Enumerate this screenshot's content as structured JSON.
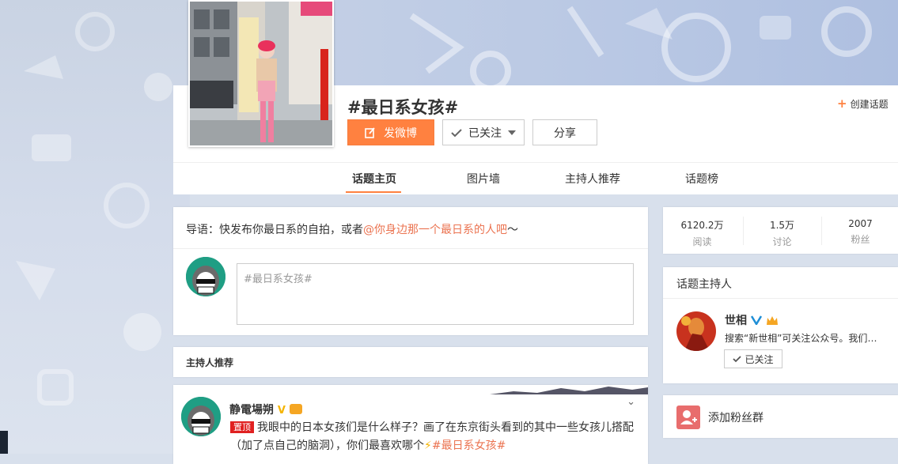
{
  "colors": {
    "accent": "#ff8140",
    "link": "#eb7350",
    "pin": "#e02020",
    "verified": "#1e8ed6"
  },
  "topic": {
    "title": "#最日系女孩#",
    "post_button": "发微博",
    "follow_button": "已关注",
    "share_button": "分享",
    "create_topic": "创建话题"
  },
  "tabs": [
    {
      "label": "话题主页",
      "active": true
    },
    {
      "label": "图片墙",
      "active": false
    },
    {
      "label": "主持人推荐",
      "active": false
    },
    {
      "label": "话题榜",
      "active": false
    }
  ],
  "intro": {
    "prefix": "导语：快发布你最日系的自拍，或者",
    "link": "@你身边那一个最日系的人吧",
    "suffix": "～"
  },
  "composer": {
    "placeholder": "#最日系女孩#"
  },
  "host_recommend": {
    "title": "主持人推荐"
  },
  "post": {
    "username": "静電場朔",
    "pin_label": "置顶",
    "text": "我眼中的日本女孩们是什么样子？画了在东京街头看到的其中一些女孩儿搭配（加了点自己的脑洞），你们最喜欢哪个",
    "tag": "#最日系女孩#"
  },
  "stats": [
    {
      "value": "6120.2万",
      "label": "阅读"
    },
    {
      "value": "1.5万",
      "label": "讨论"
    },
    {
      "value": "2007",
      "label": "粉丝"
    }
  ],
  "hosts": {
    "title": "话题主持人",
    "name": "世相",
    "desc": "搜索“新世相”可关注公众号。我们够...",
    "follow": "已关注"
  },
  "fans_group": {
    "label": "添加粉丝群"
  }
}
